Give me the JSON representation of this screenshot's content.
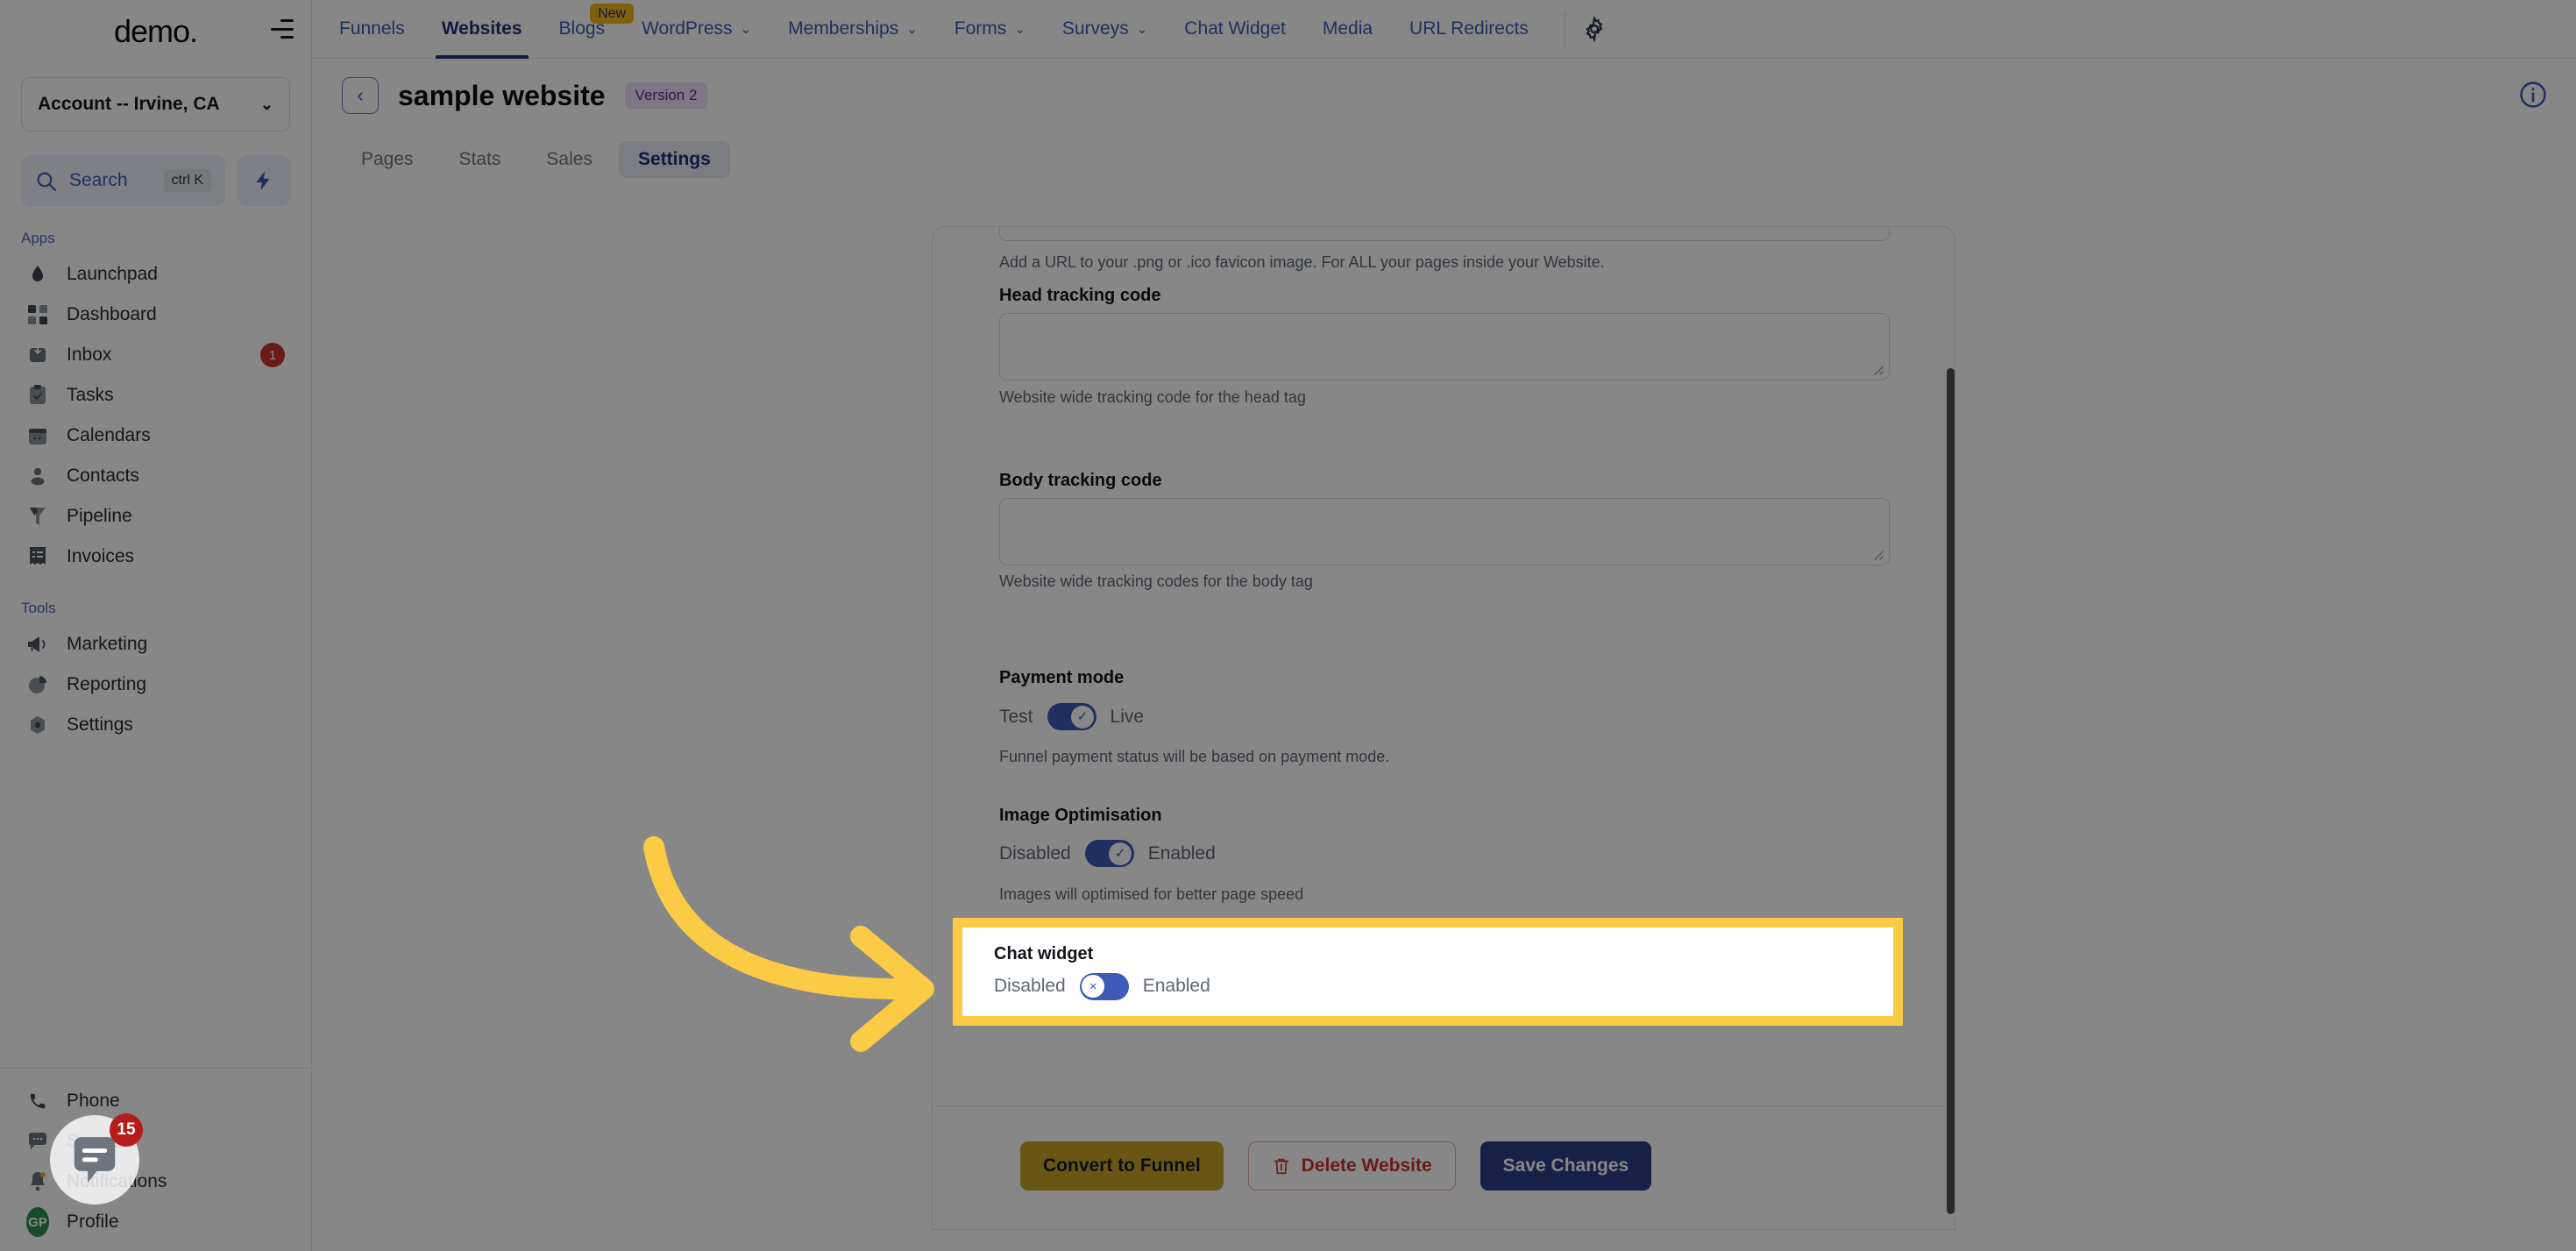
{
  "sidebar": {
    "brand": "demo",
    "brand_suffix": ".",
    "collapse_icon": "collapse-menu-icon",
    "account": {
      "label": "Account -- Irvine, CA",
      "chevron": "⌄"
    },
    "search": {
      "label": "Search",
      "shortcut": "ctrl K",
      "icon": "search-icon"
    },
    "quick_action": {
      "icon": "bolt-icon"
    },
    "section_apps": "Apps",
    "section_tools": "Tools",
    "apps": [
      {
        "label": "Launchpad",
        "icon": "launchpad-icon",
        "badge": ""
      },
      {
        "label": "Dashboard",
        "icon": "dashboard-icon",
        "badge": ""
      },
      {
        "label": "Inbox",
        "icon": "inbox-icon",
        "badge": "1"
      },
      {
        "label": "Tasks",
        "icon": "tasks-icon",
        "badge": ""
      },
      {
        "label": "Calendars",
        "icon": "calendar-icon",
        "badge": ""
      },
      {
        "label": "Contacts",
        "icon": "contacts-icon",
        "badge": ""
      },
      {
        "label": "Pipeline",
        "icon": "pipeline-icon",
        "badge": ""
      },
      {
        "label": "Invoices",
        "icon": "invoices-icon",
        "badge": ""
      }
    ],
    "tools": [
      {
        "label": "Marketing",
        "icon": "megaphone-icon"
      },
      {
        "label": "Reporting",
        "icon": "pie-chart-icon"
      },
      {
        "label": "Settings",
        "icon": "gear-icon"
      }
    ],
    "bottom": [
      {
        "label": "Phone",
        "icon": "phone-icon"
      },
      {
        "label": "Support",
        "icon": "support-chat-icon"
      },
      {
        "label": "Notifications",
        "icon": "bell-icon"
      },
      {
        "label": "Profile",
        "icon": "avatar-icon",
        "avatar_initials": "GP"
      }
    ]
  },
  "topnav": {
    "items": [
      {
        "label": "Funnels",
        "caret": false,
        "active": false,
        "badge": ""
      },
      {
        "label": "Websites",
        "caret": false,
        "active": true,
        "badge": ""
      },
      {
        "label": "Blogs",
        "caret": false,
        "active": false,
        "badge": "New"
      },
      {
        "label": "WordPress",
        "caret": true,
        "active": false,
        "badge": ""
      },
      {
        "label": "Memberships",
        "caret": true,
        "active": false,
        "badge": ""
      },
      {
        "label": "Forms",
        "caret": true,
        "active": false,
        "badge": ""
      },
      {
        "label": "Surveys",
        "caret": true,
        "active": false,
        "badge": ""
      },
      {
        "label": "Chat Widget",
        "caret": false,
        "active": false,
        "badge": ""
      },
      {
        "label": "Media",
        "caret": false,
        "active": false,
        "badge": ""
      },
      {
        "label": "URL Redirects",
        "caret": false,
        "active": false,
        "badge": ""
      }
    ],
    "caret_glyph": "⌄",
    "gear_icon": "gear-icon"
  },
  "page": {
    "back_glyph": "‹",
    "title": "sample website",
    "version_badge": "Version 2",
    "info_icon": "info-circle-icon",
    "tabs": [
      {
        "label": "Pages",
        "active": false
      },
      {
        "label": "Stats",
        "active": false
      },
      {
        "label": "Sales",
        "active": false
      },
      {
        "label": "Settings",
        "active": true
      }
    ]
  },
  "settings": {
    "favicon_hint": "Add a URL to your .png or .ico favicon image. For ALL your pages inside your Website.",
    "head_tracking": {
      "label": "Head tracking code",
      "value": "",
      "placeholder": "",
      "hint": "Website wide tracking code for the head tag"
    },
    "body_tracking": {
      "label": "Body tracking code",
      "value": "",
      "placeholder": "",
      "hint": "Website wide tracking codes for the body tag"
    },
    "payment_mode": {
      "label": "Payment mode",
      "off_label": "Test",
      "on_label": "Live",
      "state": "on",
      "knob_glyph": "✓",
      "hint": "Funnel payment status will be based on payment mode."
    },
    "image_optimisation": {
      "label": "Image Optimisation",
      "off_label": "Disabled",
      "on_label": "Enabled",
      "state": "on",
      "knob_glyph": "✓",
      "hint": "Images will optimised for better page speed"
    },
    "chat_widget": {
      "label": "Chat widget",
      "off_label": "Disabled",
      "on_label": "Enabled",
      "state": "off",
      "knob_glyph": "×",
      "highlight_color": "#FBCB45"
    },
    "actions": {
      "convert": "Convert to Funnel",
      "delete": "Delete Website",
      "delete_icon": "trash-icon",
      "save": "Save Changes"
    }
  },
  "annotation": {
    "arrow_color": "#FBCB45",
    "arrow_icon": "curved-arrow-right-icon"
  },
  "chat_launcher": {
    "icon": "chat-bubble-icon",
    "badge": "15"
  },
  "colors": {
    "accent_blue": "#3c5ab6",
    "nav_active": "#22307a",
    "highlight_yellow": "#FBCB45",
    "danger_red": "#c9332c",
    "save_blue": "#2c3f86",
    "convert_gold": "#c9a227"
  }
}
